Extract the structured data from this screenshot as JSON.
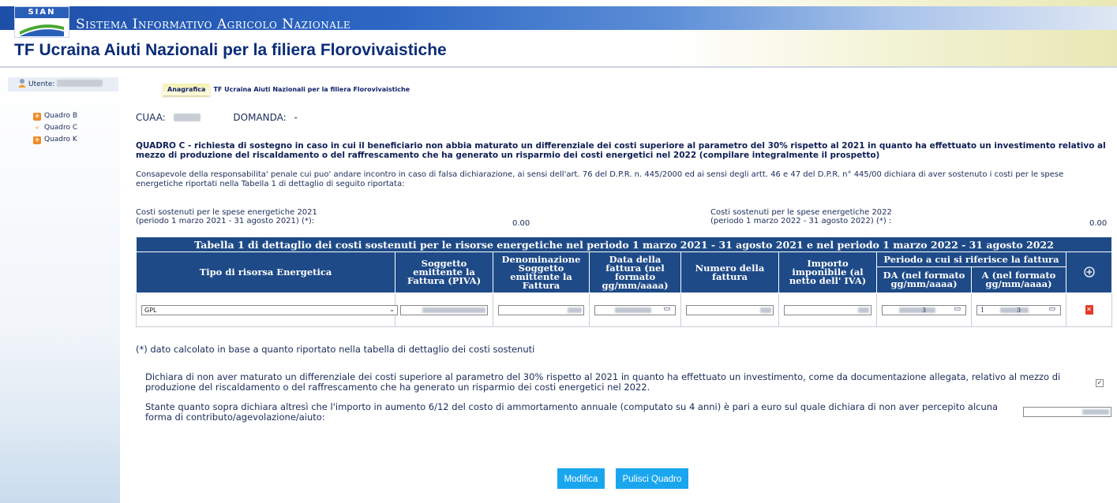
{
  "header": {
    "logo_text": "SIAN",
    "banner_title": "Sistema Informativo Agricolo Nazionale",
    "page_title": "TF Ucraina Aiuti Nazionali per la filiera Florovivaistiche"
  },
  "sidebar": {
    "user_label": "Utente:",
    "items": [
      {
        "label": "Quadro B",
        "icon": "orange-square-icon"
      },
      {
        "label": "Quadro C",
        "icon": "bullet-icon"
      },
      {
        "label": "Quadro K",
        "icon": "orange-square-icon"
      }
    ]
  },
  "tabs": {
    "active": "Anagrafica",
    "description": "TF Ucraina Aiuti Nazionali per la filiera Florovivaistiche"
  },
  "info": {
    "cuaa_label": "CUAA:",
    "domanda_label": "DOMANDA:",
    "domanda_value": "-"
  },
  "quadro": {
    "title": "QUADRO C - richiesta di sostegno in caso in cui il beneficiario non abbia maturato un differenziale dei costi superiore al parametro del 30% rispetto al 2021 in quanto ha effettuato un investimento relativo al mezzo di produzione del riscaldamento o del raffrescamento che ha generato un risparmio dei costi energetici nel 2022 (compilare integralmente il prospetto)",
    "consapevole": "Consapevole della responsabilita' penale cui puo' andare incontro in caso di falsa dichiarazione, ai sensi dell'art. 76 del D.P.R. n. 445/2000 ed ai sensi degli artt. 46 e 47 del D.P.R. n° 445/00 dichiara di aver sostenuto i costi per le spese energetiche riportati nella Tabella 1 di dettaglio di seguito riportata:"
  },
  "costi": {
    "c2021_line1": "Costi sostenuti per le spese energetiche 2021",
    "c2021_line2": "(periodo 1 marzo 2021 - 31 agosto 2021) (*):",
    "c2021_value": "0.00",
    "c2022_line1": "Costi sostenuti per le spese energetiche 2022",
    "c2022_line2": "(periodo 1 marzo 2022 - 31 agosto 2022) (*) :",
    "c2022_value": "0.00"
  },
  "table": {
    "caption": "Tabella 1 di dettaglio dei costi sostenuti per le risorse energetiche nel periodo 1 marzo 2021 - 31 agosto 2021 e nel periodo 1 marzo 2022 - 31 agosto 2022",
    "headers": {
      "tipo": "Tipo di risorsa Energetica",
      "soggetto": "Soggetto emittente la Fattura (PIVA)",
      "denominazione": "Denominazione Soggetto emittente la Fattura",
      "data": "Data della fattura (nel formato gg/mm/aaaa)",
      "numero": "Numero della fattura",
      "importo": "Importo imponibile (al netto dell' IVA)",
      "periodo": "Periodo a cui si riferisce la fattura",
      "da": "DA (nel formato gg/mm/aaaa)",
      "a": "A (nel formato gg/mm/aaaa)"
    },
    "row": {
      "tipo_value": "GPL",
      "da_suffix": "3",
      "a_prefix": "1",
      "a_suffix": "3"
    }
  },
  "note": "(*) dato calcolato in base a quanto riportato nella tabella di dettaglio dei costi sostenuti",
  "declaration": {
    "text": "Dichiara di non aver maturato un differenziale dei costi superiore al parametro del 30% rispetto al 2021 in quanto ha effettuato un investimento, come da documentazione allegata, relativo al mezzo di produzione del riscaldamento o del raffrescamento che ha generato un risparmio dei costi energetici nel 2022.",
    "checked": true,
    "stante": "Stante quanto sopra dichiara altresì che l'importo in aumento 6/12 del costo di ammortamento annuale (computato su 4 anni) è pari a euro sul quale dichiara di non aver percepito alcuna forma di contributo/agevolazione/aiuto:"
  },
  "buttons": {
    "modifica": "Modifica",
    "pulisci": "Pulisci Quadro"
  },
  "colors": {
    "table_header": "#1e4a87",
    "button": "#1aa6ee",
    "title": "#0a2c78"
  }
}
